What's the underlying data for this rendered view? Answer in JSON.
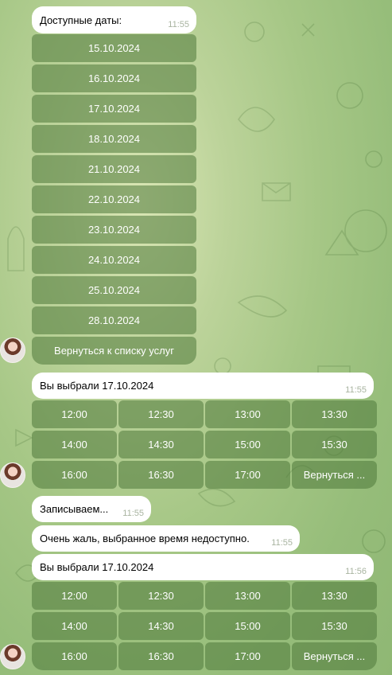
{
  "chat": {
    "msg_dates": {
      "text": "Доступные даты:",
      "time": "11:55"
    },
    "date_buttons": [
      "15.10.2024",
      "16.10.2024",
      "17.10.2024",
      "18.10.2024",
      "21.10.2024",
      "22.10.2024",
      "23.10.2024",
      "24.10.2024",
      "25.10.2024",
      "28.10.2024"
    ],
    "back_to_services": "Вернуться к списку услуг",
    "msg_chosen_1": {
      "text": "Вы выбрали 17.10.2024",
      "time": "11:55"
    },
    "times_1": [
      "12:00",
      "12:30",
      "13:00",
      "13:30",
      "14:00",
      "14:30",
      "15:00",
      "15:30",
      "16:00",
      "16:30",
      "17:00",
      "Вернуться ..."
    ],
    "msg_booking": {
      "text": "Записываем...",
      "time": "11:55"
    },
    "msg_unavailable": {
      "text": "Очень жаль, выбранное время недоступно.",
      "time": "11:55"
    },
    "msg_chosen_2": {
      "text": "Вы выбрали 17.10.2024",
      "time": "11:56"
    },
    "times_2": [
      "12:00",
      "12:30",
      "13:00",
      "13:30",
      "14:00",
      "14:30",
      "15:00",
      "15:30",
      "16:00",
      "16:30",
      "17:00",
      "Вернуться ..."
    ]
  },
  "avatar_icon": "bot-avatar-icon",
  "colors": {
    "button_bg": "#4e783a",
    "bubble_bg": "#ffffff",
    "time_text": "#a8b4a0"
  }
}
